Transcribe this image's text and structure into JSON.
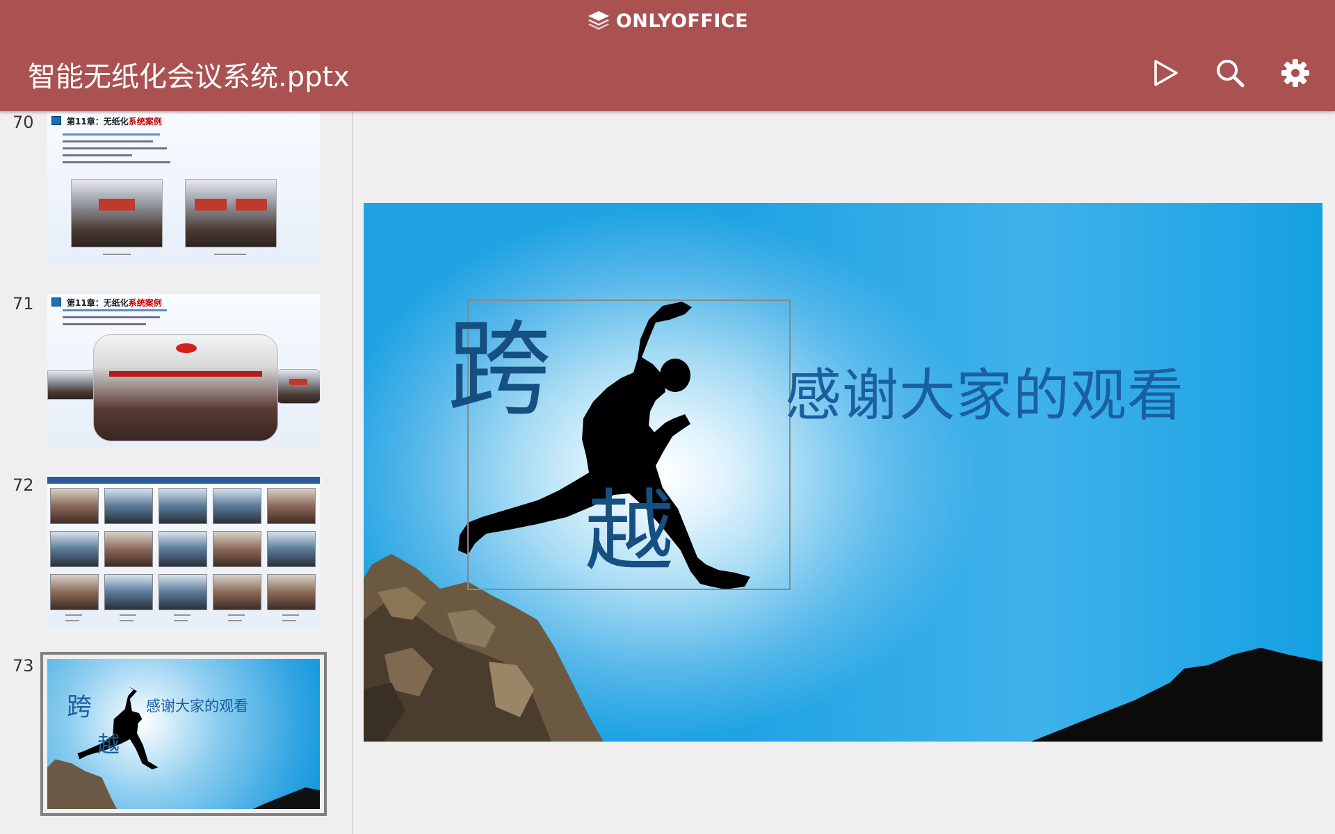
{
  "header": {
    "brand": "ONLYOFFICE",
    "doc_title": "智能无纸化会议系统.pptx",
    "color": "#aa5252"
  },
  "thumbnails": [
    {
      "number": "70",
      "title_prefix": "第11章：无纸化",
      "title_suffix": "系统案例"
    },
    {
      "number": "71",
      "title_prefix": "第11章：无纸化",
      "title_suffix": "系统案例"
    },
    {
      "number": "72"
    },
    {
      "number": "73",
      "selected": true,
      "char_1": "跨",
      "char_2": "越",
      "text": "感谢大家的观看"
    }
  ],
  "slide": {
    "char_1": "跨",
    "char_2": "越",
    "text": "感谢大家的观看",
    "text_color": "#1a5fa0"
  },
  "icons": {
    "play": "play-icon",
    "search": "search-icon",
    "settings": "gear-icon",
    "logo": "onlyoffice-logo-icon"
  }
}
